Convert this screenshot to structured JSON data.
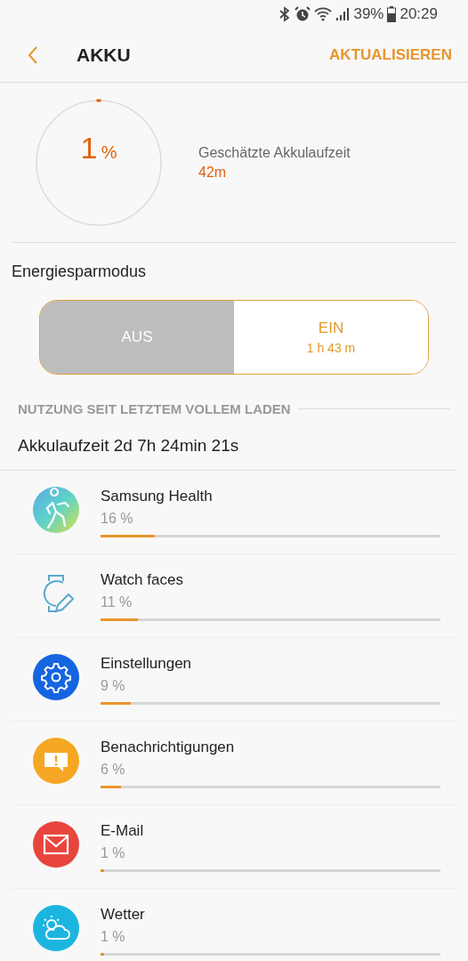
{
  "status_bar": {
    "battery_percent": "39%",
    "time": "20:29"
  },
  "header": {
    "title": "AKKU",
    "action": "AKTUALISIEREN"
  },
  "battery": {
    "percent": "1",
    "unit": "%",
    "level": 0.01,
    "estimate_label": "Geschätzte Akkulaufzeit",
    "estimate_value": "42m"
  },
  "power_saving": {
    "label": "Energiesparmodus",
    "options": [
      {
        "label": "AUS",
        "selected": true
      },
      {
        "label": "EIN",
        "detail": "1 h 43 m",
        "selected": false
      }
    ]
  },
  "usage": {
    "heading": "NUTZUNG SEIT LETZTEM VOLLEM LADEN",
    "total": "Akkulaufzeit 2d 7h 24min 21s",
    "apps": [
      {
        "kind": "health",
        "name": "Samsung Health",
        "percent": "16 %",
        "level": 0.16
      },
      {
        "kind": "watchfaces",
        "name": "Watch faces",
        "percent": "11 %",
        "level": 0.11
      },
      {
        "kind": "settings",
        "name": "Einstellungen",
        "percent": "9 %",
        "level": 0.09
      },
      {
        "kind": "notifications",
        "name": "Benachrichtigungen",
        "percent": "6 %",
        "level": 0.06
      },
      {
        "kind": "email",
        "name": "E-Mail",
        "percent": "1 %",
        "level": 0.01
      },
      {
        "kind": "weather",
        "name": "Wetter",
        "percent": "1 %",
        "level": 0.01
      }
    ]
  }
}
